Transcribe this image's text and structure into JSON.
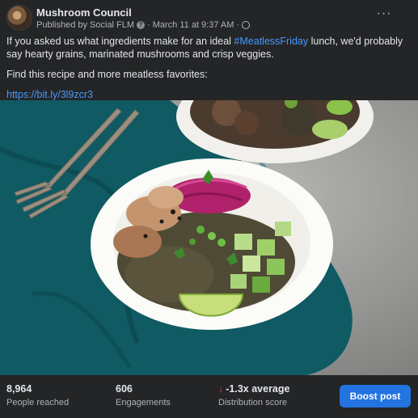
{
  "post": {
    "page_name": "Mushroom Council",
    "published_by": "Published by Social FLM",
    "date": "March 11 at 9:37 AM",
    "separator": "·",
    "text_before_hashtag": "If you asked us what ingredients make for an ideal ",
    "hashtag": "#MeatlessFriday",
    "text_after_hashtag": " lunch, we'd probably say hearty grains, marinated mushrooms and crisp veggies.",
    "line_two": "Find this recipe and more meatless favorites:",
    "link": "https://bit.ly/3l9zcr3",
    "more_label": "···",
    "help_glyph": "?",
    "image_icon": "lentil-mushroom-bowl-photo"
  },
  "stats": {
    "reach_value": "8,964",
    "reach_label": "People reached",
    "engagements_value": "606",
    "engagements_label": "Engagements",
    "distribution_arrow": "↓",
    "distribution_value": "-1.3x average",
    "distribution_label": "Distribution score",
    "boost_label": "Boost post"
  },
  "colors": {
    "background": "#242526",
    "link": "#4599ff",
    "boost": "#2374e1",
    "negative": "#f02849",
    "cloth": "#0f5a63",
    "table": "#8f8f8f"
  }
}
